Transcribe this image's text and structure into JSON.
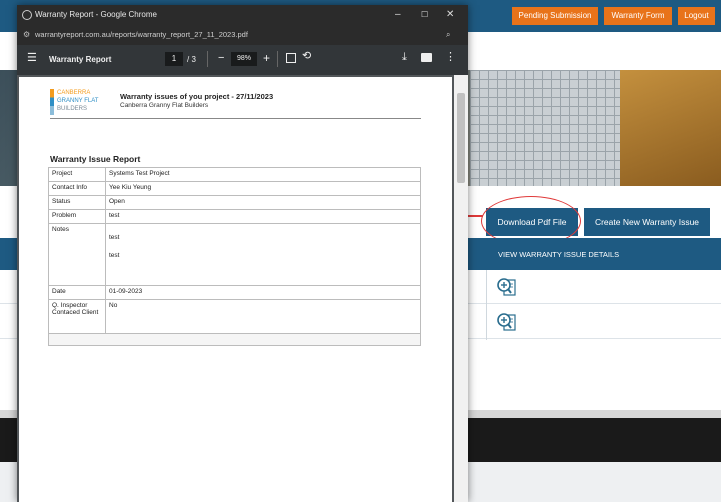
{
  "site": {
    "nav": [
      "Pending Submission",
      "Warranty Form",
      "Logout"
    ],
    "download_button": "Download Pdf File",
    "create_button": "Create New Warranty Issue",
    "table_header": "VIEW WARRANTY ISSUE DETAILS",
    "row_icons": [
      "magnifier-document-icon",
      "magnifier-document-icon"
    ],
    "colors": {
      "brand_blue": "#1e5a82",
      "nav_orange": "#e8731a",
      "annotation_red": "#e03a3a"
    }
  },
  "browser": {
    "window_title": "Warranty Report - Google Chrome",
    "url": "warrantyreport.com.au/reports/warranty_report_27_11_2023.pdf",
    "pdf_title": "Warranty Report",
    "page_current": "1",
    "page_separator": "/ 3",
    "zoom": "98%"
  },
  "report": {
    "logo_lines": [
      "CANBERRA",
      "GRANNY FLAT",
      "BUILDERS"
    ],
    "heading": "Warranty issues of you project - 27/11/2023",
    "subheading": "Canberra Granny Flat Builders",
    "section_title": "Warranty Issue Report",
    "rows": [
      {
        "label": "Project",
        "value": "Systems Test Project"
      },
      {
        "label": "Contact Info",
        "value": "Yee Kiu Yeung"
      },
      {
        "label": "Status",
        "value": "Open"
      },
      {
        "label": "Problem",
        "value": "test"
      },
      {
        "label": "Notes",
        "value": "test",
        "value2": "test"
      },
      {
        "label": "Date",
        "value": "01-09-2023"
      },
      {
        "label": "Q. Inspector Contaced Client",
        "value": "No"
      }
    ]
  }
}
